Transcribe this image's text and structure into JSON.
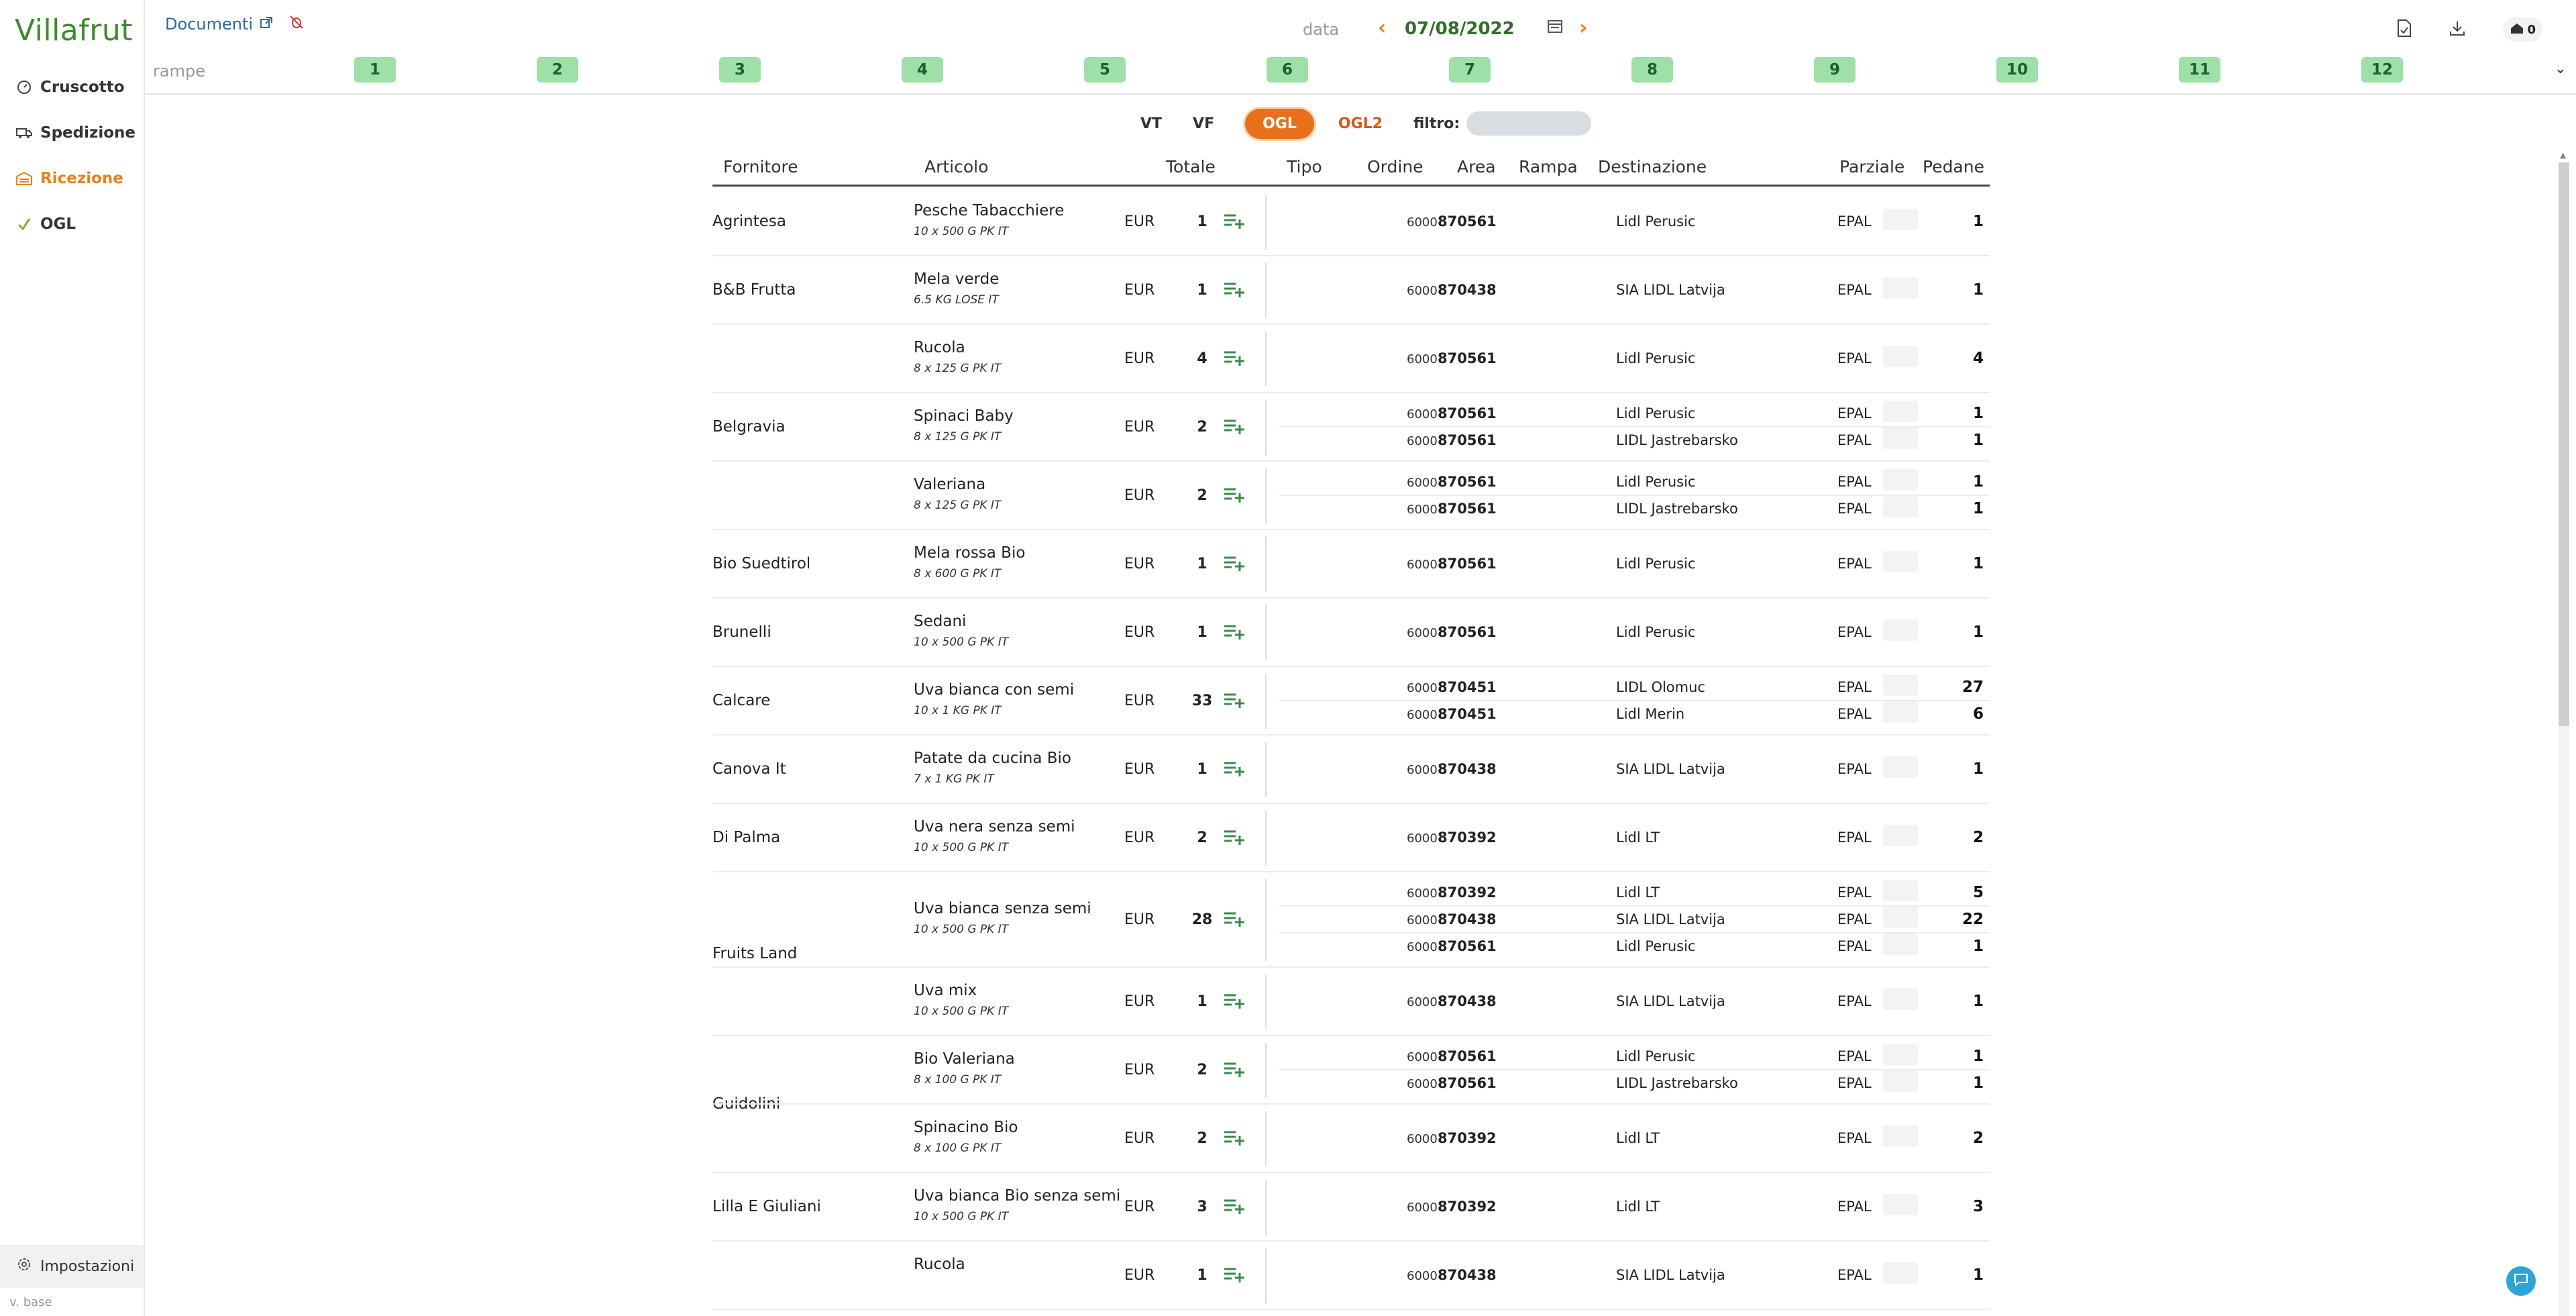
{
  "app": {
    "logo": "Villafrut",
    "version": "v. base"
  },
  "sidebar": {
    "items": [
      {
        "label": "Cruscotto",
        "icon": "dashboard-icon"
      },
      {
        "label": "Spedizione",
        "icon": "truck-icon"
      },
      {
        "label": "Ricezione",
        "icon": "warehouse-icon",
        "active": true
      },
      {
        "label": "OGL",
        "icon": "check-icon"
      }
    ],
    "settings_label": "Impostazioni"
  },
  "header": {
    "docs_label": "Documenti",
    "date_label": "data",
    "date_value": "07/08/2022",
    "user_count": "0"
  },
  "ramps": {
    "label": "rampe",
    "items": [
      "1",
      "2",
      "3",
      "4",
      "5",
      "6",
      "7",
      "8",
      "9",
      "10",
      "11",
      "12"
    ]
  },
  "filter": {
    "tabs": [
      "VT",
      "VF",
      "OGL",
      "OGL2"
    ],
    "active": "OGL",
    "filter_label": "filtro:"
  },
  "table": {
    "columns": [
      "Fornitore",
      "Articolo",
      "Totale",
      "Tipo",
      "Ordine",
      "Area",
      "Rampa",
      "Destinazione",
      "Parziale",
      "Pedane"
    ],
    "currency": "EUR",
    "order_prefix": "6000",
    "pallet_type": "EPAL",
    "suppliers": [
      {
        "name": "Agrintesa",
        "articles": [
          {
            "name": "Pesche Tabacchiere",
            "format": "10 x 500 G PK IT",
            "total": "1",
            "dest": [
              {
                "order": "870561",
                "dest": "Lidl Perusic",
                "pallets": "1"
              }
            ]
          }
        ]
      },
      {
        "name": "B&B Frutta",
        "articles": [
          {
            "name": "Mela verde",
            "format": "6.5 KG LOSE IT",
            "total": "1",
            "dest": [
              {
                "order": "870438",
                "dest": "SIA LIDL Latvija",
                "pallets": "1"
              }
            ]
          }
        ]
      },
      {
        "name": "Belgravia",
        "articles": [
          {
            "name": "Rucola",
            "format": "8 x 125 G PK IT",
            "total": "4",
            "dest": [
              {
                "order": "870561",
                "dest": "Lidl Perusic",
                "pallets": "4"
              }
            ]
          },
          {
            "name": "Spinaci Baby",
            "format": "8 x 125 G PK IT",
            "total": "2",
            "dest": [
              {
                "order": "870561",
                "dest": "Lidl Perusic",
                "pallets": "1"
              },
              {
                "order": "870561",
                "dest": "LIDL Jastrebarsko",
                "pallets": "1"
              }
            ]
          },
          {
            "name": "Valeriana",
            "format": "8 x 125 G PK IT",
            "total": "2",
            "dest": [
              {
                "order": "870561",
                "dest": "Lidl Perusic",
                "pallets": "1"
              },
              {
                "order": "870561",
                "dest": "LIDL Jastrebarsko",
                "pallets": "1"
              }
            ]
          }
        ]
      },
      {
        "name": "Bio Suedtirol",
        "articles": [
          {
            "name": "Mela rossa Bio",
            "format": "8 x 600 G PK IT",
            "total": "1",
            "dest": [
              {
                "order": "870561",
                "dest": "Lidl Perusic",
                "pallets": "1"
              }
            ]
          }
        ]
      },
      {
        "name": "Brunelli",
        "articles": [
          {
            "name": "Sedani",
            "format": "10 x 500 G PK IT",
            "total": "1",
            "dest": [
              {
                "order": "870561",
                "dest": "Lidl Perusic",
                "pallets": "1"
              }
            ]
          }
        ]
      },
      {
        "name": "Calcare",
        "articles": [
          {
            "name": "Uva bianca con semi",
            "format": "10 x 1 KG PK IT",
            "total": "33",
            "dest": [
              {
                "order": "870451",
                "dest": "LIDL Olomuc",
                "pallets": "27"
              },
              {
                "order": "870451",
                "dest": "Lidl Merin",
                "pallets": "6"
              }
            ]
          }
        ]
      },
      {
        "name": "Canova It",
        "articles": [
          {
            "name": "Patate da cucina Bio",
            "format": "7 x 1 KG PK IT",
            "total": "1",
            "dest": [
              {
                "order": "870438",
                "dest": "SIA LIDL Latvija",
                "pallets": "1"
              }
            ]
          }
        ]
      },
      {
        "name": "Di Palma",
        "articles": [
          {
            "name": "Uva nera senza semi",
            "format": "10 x 500 G PK IT",
            "total": "2",
            "dest": [
              {
                "order": "870392",
                "dest": "Lidl LT",
                "pallets": "2"
              }
            ]
          }
        ]
      },
      {
        "name": "Fruits Land",
        "articles": [
          {
            "name": "Uva bianca senza semi",
            "format": "10 x 500 G PK IT",
            "total": "28",
            "dest": [
              {
                "order": "870392",
                "dest": "Lidl LT",
                "pallets": "5"
              },
              {
                "order": "870438",
                "dest": "SIA LIDL Latvija",
                "pallets": "22"
              },
              {
                "order": "870561",
                "dest": "Lidl Perusic",
                "pallets": "1"
              }
            ]
          },
          {
            "name": "Uva mix",
            "format": "10 x 500 G PK IT",
            "total": "1",
            "dest": [
              {
                "order": "870438",
                "dest": "SIA LIDL Latvija",
                "pallets": "1"
              }
            ]
          }
        ]
      },
      {
        "name": "Guidolini",
        "articles": [
          {
            "name": "Bio Valeriana",
            "format": "8 x 100 G PK IT",
            "total": "2",
            "dest": [
              {
                "order": "870561",
                "dest": "Lidl Perusic",
                "pallets": "1"
              },
              {
                "order": "870561",
                "dest": "LIDL Jastrebarsko",
                "pallets": "1"
              }
            ]
          },
          {
            "name": "Spinacino Bio",
            "format": "8 x 100 G PK IT",
            "total": "2",
            "dest": [
              {
                "order": "870392",
                "dest": "Lidl LT",
                "pallets": "2"
              }
            ]
          }
        ]
      },
      {
        "name": "Lilla E Giuliani",
        "articles": [
          {
            "name": "Uva bianca Bio senza semi",
            "format": "10 x 500 G PK IT",
            "total": "3",
            "dest": [
              {
                "order": "870392",
                "dest": "Lidl LT",
                "pallets": "3"
              }
            ]
          }
        ]
      },
      {
        "name": "",
        "articles": [
          {
            "name": "Rucola",
            "format": "",
            "total": "1",
            "dest": [
              {
                "order": "870438",
                "dest": "SIA LIDL Latvija",
                "pallets": "1"
              }
            ]
          }
        ]
      }
    ]
  }
}
